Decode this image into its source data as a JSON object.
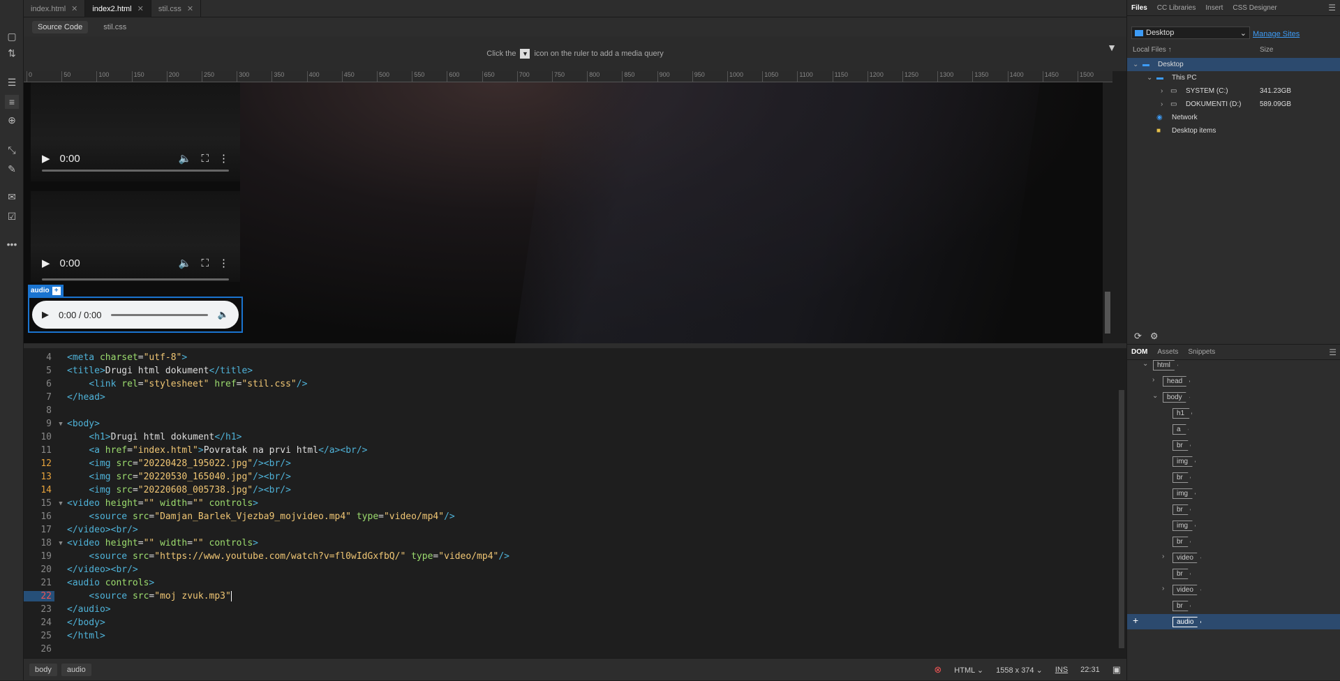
{
  "tabs": [
    {
      "label": "index.html",
      "active": false
    },
    {
      "label": "index2.html",
      "active": true
    },
    {
      "label": "stil.css",
      "active": false
    }
  ],
  "docbar": {
    "source_code": "Source Code",
    "related_file": "stil.css"
  },
  "mq_hint": {
    "before": "Click the",
    "after": "icon on the ruler to add a media query"
  },
  "ruler_labels": [
    "0",
    "50",
    "100",
    "150",
    "200",
    "250",
    "300",
    "350",
    "400",
    "450",
    "500",
    "550",
    "600",
    "650",
    "700",
    "750",
    "800",
    "850",
    "900",
    "950",
    "1000",
    "1050",
    "1100",
    "1150",
    "1200",
    "1250",
    "1300",
    "1350",
    "1400",
    "1450",
    "1500"
  ],
  "videos": [
    {
      "time": "0:00"
    },
    {
      "time": "0:00"
    }
  ],
  "audio": {
    "tag_label": "audio",
    "time": "0:00 / 0:00"
  },
  "code_lines": [
    {
      "n": "4",
      "html": "<span class='tg'>&lt;meta</span> <span class='at'>charset</span>=<span class='st'>\"utf-8\"</span><span class='tg'>&gt;</span>",
      "indent": 0
    },
    {
      "n": "5",
      "html": "<span class='tg'>&lt;title&gt;</span>Drugi html dokument<span class='tg'>&lt;/title&gt;</span>",
      "indent": 0
    },
    {
      "n": "6",
      "html": "    <span class='tg'>&lt;link</span> <span class='at'>rel</span>=<span class='st'>\"stylesheet\"</span> <span class='at'>href</span>=<span class='st'>\"stil.css\"</span><span class='tg'>/&gt;</span>",
      "indent": 0
    },
    {
      "n": "7",
      "html": "<span class='tg'>&lt;/head&gt;</span>",
      "indent": 0
    },
    {
      "n": "8",
      "html": "",
      "indent": 0
    },
    {
      "n": "9",
      "html": "<span class='tg'>&lt;body&gt;</span>",
      "fold": true
    },
    {
      "n": "10",
      "html": "    <span class='tg'>&lt;h1&gt;</span>Drugi html dokument<span class='tg'>&lt;/h1&gt;</span>"
    },
    {
      "n": "11",
      "html": "    <span class='tg'>&lt;a</span> <span class='at'>href</span>=<span class='st'>\"index.html\"</span><span class='tg'>&gt;</span>Povratak na prvi html<span class='tg'>&lt;/a&gt;&lt;br/&gt;</span>"
    },
    {
      "n": "12",
      "mod": true,
      "html": "    <span class='tg'>&lt;img</span> <span class='at'>src</span>=<span class='st'>\"20220428_195022.jpg\"</span><span class='tg'>/&gt;&lt;br/&gt;</span>"
    },
    {
      "n": "13",
      "mod": true,
      "html": "    <span class='tg'>&lt;img</span> <span class='at'>src</span>=<span class='st'>\"20220530_165040.jpg\"</span><span class='tg'>/&gt;&lt;br/&gt;</span>"
    },
    {
      "n": "14",
      "mod": true,
      "html": "    <span class='tg'>&lt;img</span> <span class='at'>src</span>=<span class='st'>\"20220608_005738.jpg\"</span><span class='tg'>/&gt;&lt;br/&gt;</span>"
    },
    {
      "n": "15",
      "fold": true,
      "html": "<span class='tg'>&lt;video</span> <span class='at'>height</span>=<span class='st'>\"\"</span> <span class='at'>width</span>=<span class='st'>\"\"</span> <span class='at'>controls</span><span class='tg'>&gt;</span>"
    },
    {
      "n": "16",
      "html": "    <span class='tg'>&lt;source</span> <span class='at'>src</span>=<span class='st'>\"Damjan_Barlek_Vjezba9_mojvideo.mp4\"</span> <span class='at'>type</span>=<span class='st'>\"video/mp4\"</span><span class='tg'>/&gt;</span>"
    },
    {
      "n": "17",
      "html": "<span class='tg'>&lt;/video&gt;&lt;br/&gt;</span>"
    },
    {
      "n": "18",
      "fold": true,
      "html": "<span class='tg'>&lt;video</span> <span class='at'>height</span>=<span class='st'>\"\"</span> <span class='at'>width</span>=<span class='st'>\"\"</span> <span class='at'>controls</span><span class='tg'>&gt;</span>"
    },
    {
      "n": "19",
      "html": "    <span class='tg'>&lt;source</span> <span class='at'>src</span>=<span class='st'>\"https://www.youtube.com/watch?v=fl0wIdGxfbQ/\"</span> <span class='at'>type</span>=<span class='st'>\"video/mp4\"</span><span class='tg'>/&gt;</span>"
    },
    {
      "n": "20",
      "html": "<span class='tg'>&lt;/video&gt;&lt;br/&gt;</span>"
    },
    {
      "n": "21",
      "html": "<span class='tg'>&lt;audio</span> <span class='at'>controls</span><span class='tg'>&gt;</span>"
    },
    {
      "n": "22",
      "cur": true,
      "html": "    <span class='tg'>&lt;source</span> <span class='at'>src</span>=<span class='st'>\"moj zvuk.mp3\"</span><span style='border-left:1px solid #fff'></span>"
    },
    {
      "n": "23",
      "html": "<span class='tg'>&lt;/audio&gt;</span>"
    },
    {
      "n": "24",
      "html": "<span class='tg'>&lt;/body&gt;</span>"
    },
    {
      "n": "25",
      "html": "<span class='tg'>&lt;/html&gt;</span>"
    },
    {
      "n": "26",
      "html": ""
    }
  ],
  "status": {
    "crumbs": [
      "body",
      "audio"
    ],
    "language": "HTML",
    "dimensions": "1558 x 374",
    "mode": "INS",
    "position": "22:31"
  },
  "files_panel": {
    "tabs": [
      "Files",
      "CC Libraries",
      "Insert",
      "CSS Designer"
    ],
    "site": "Desktop",
    "manage_sites": "Manage Sites",
    "col_local": "Local Files",
    "col_size": "Size",
    "tree": [
      {
        "label": "Desktop",
        "size": "",
        "depth": 0,
        "expanded": true,
        "icon": "desktop-icon",
        "selected": true
      },
      {
        "label": "This PC",
        "size": "",
        "depth": 1,
        "expanded": true,
        "icon": "computer-icon"
      },
      {
        "label": "SYSTEM (C:)",
        "size": "341.23GB",
        "depth": 2,
        "expanded": false,
        "icon": "drive-icon"
      },
      {
        "label": "DOKUMENTI (D:)",
        "size": "589.09GB",
        "depth": 2,
        "expanded": false,
        "icon": "drive-icon"
      },
      {
        "label": "Network",
        "size": "",
        "depth": 1,
        "icon": "network-icon"
      },
      {
        "label": "Desktop items",
        "size": "",
        "depth": 1,
        "icon": "folder-icon"
      }
    ]
  },
  "dom_panel": {
    "tabs": [
      "DOM",
      "Assets",
      "Snippets"
    ],
    "nodes": [
      {
        "label": "html",
        "depth": 0,
        "exp": "open"
      },
      {
        "label": "head",
        "depth": 1,
        "exp": "closed"
      },
      {
        "label": "body",
        "depth": 1,
        "exp": "open"
      },
      {
        "label": "h1",
        "depth": 2
      },
      {
        "label": "a",
        "depth": 2
      },
      {
        "label": "br",
        "depth": 2
      },
      {
        "label": "img",
        "depth": 2
      },
      {
        "label": "br",
        "depth": 2
      },
      {
        "label": "img",
        "depth": 2
      },
      {
        "label": "br",
        "depth": 2
      },
      {
        "label": "img",
        "depth": 2
      },
      {
        "label": "br",
        "depth": 2
      },
      {
        "label": "video",
        "depth": 2,
        "exp": "closed"
      },
      {
        "label": "br",
        "depth": 2
      },
      {
        "label": "video",
        "depth": 2,
        "exp": "closed"
      },
      {
        "label": "br",
        "depth": 2
      },
      {
        "label": "audio",
        "depth": 2,
        "selected": true
      }
    ]
  },
  "colors": {
    "accent": "#1a74d0",
    "link": "#3d9bf5",
    "selection": "#2c4a6e"
  }
}
